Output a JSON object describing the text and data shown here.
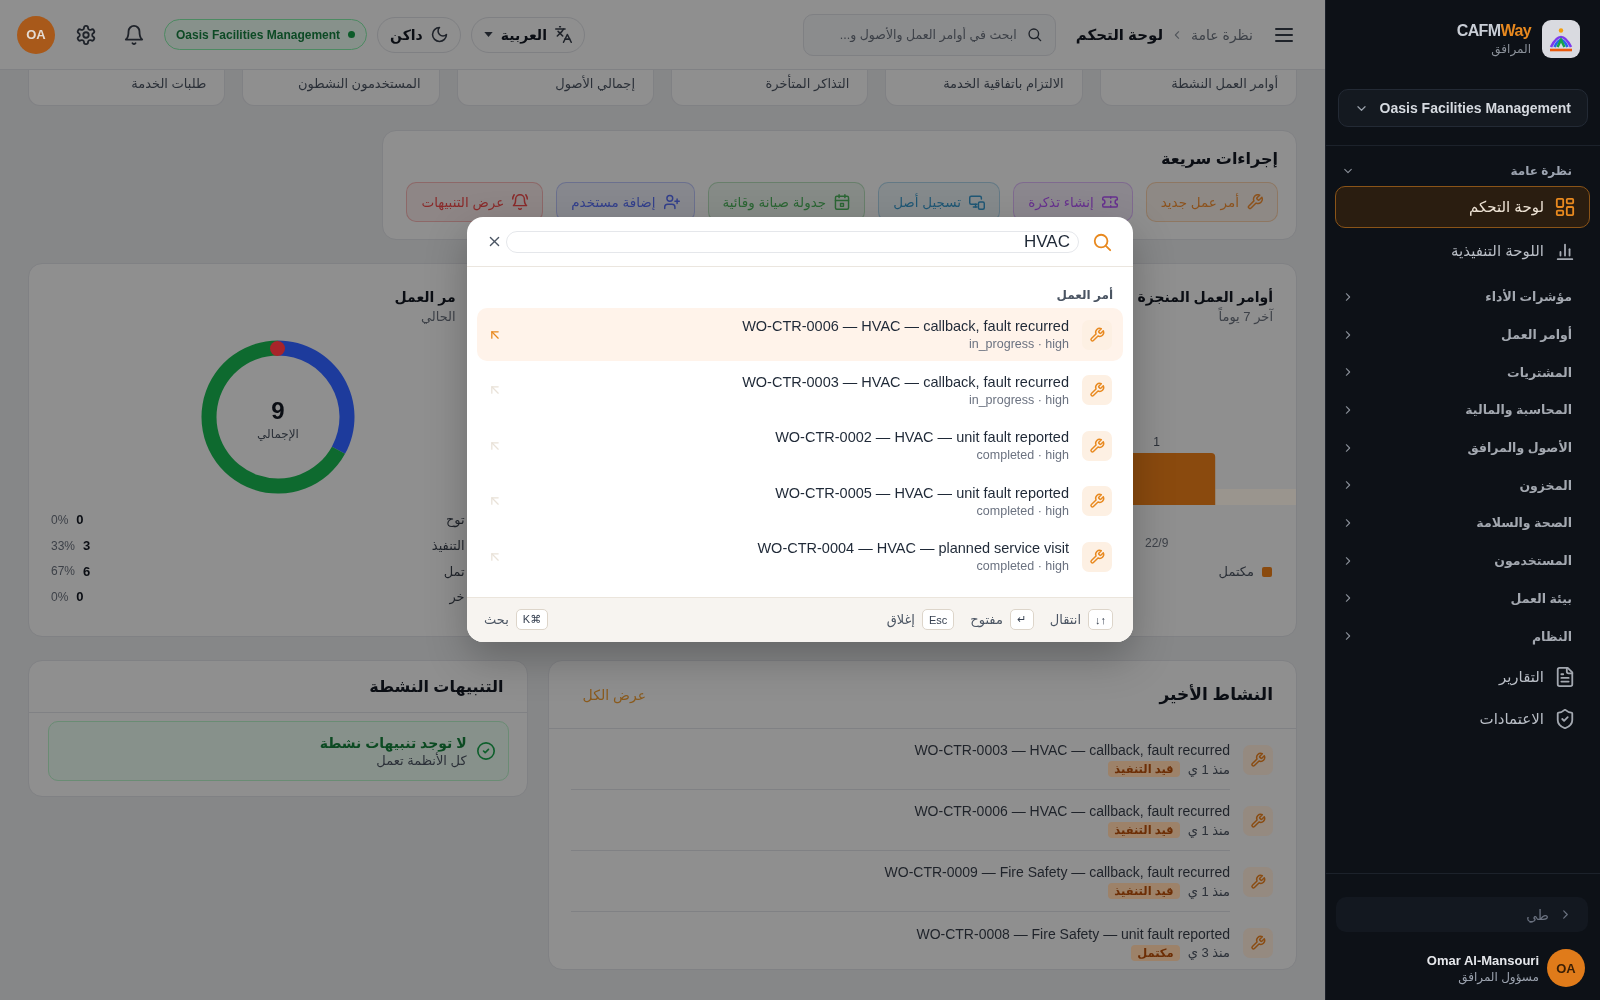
{
  "sidebar": {
    "brand": {
      "name": "CAFM",
      "accent": "Way",
      "subtitle": "المرافق"
    },
    "organization": "Oasis Facilities Management",
    "nav": [
      {
        "kind": "section",
        "label": "نظرة عامة",
        "expanded": true,
        "children": [
          {
            "label": "لوحة التحكم",
            "selected": true
          },
          {
            "label": "اللوحة التنفيذية",
            "selected": false
          }
        ]
      },
      {
        "kind": "group",
        "label": "مؤشرات الأداء",
        "expanded": false
      },
      {
        "kind": "group",
        "label": "أوامر العمل",
        "expanded": false
      },
      {
        "kind": "group",
        "label": "المشتريات",
        "expanded": false
      },
      {
        "kind": "group",
        "label": "المحاسبة والمالية",
        "expanded": false
      },
      {
        "kind": "group",
        "label": "الأصول والمرافق",
        "expanded": false
      },
      {
        "kind": "group",
        "label": "المخزون",
        "expanded": false
      },
      {
        "kind": "group",
        "label": "الصحة والسلامة",
        "expanded": false
      },
      {
        "kind": "group",
        "label": "المستخدمون",
        "expanded": false
      },
      {
        "kind": "group",
        "label": "بيئة العمل",
        "expanded": false
      },
      {
        "kind": "group",
        "label": "النظام",
        "expanded": false
      },
      {
        "kind": "link",
        "label": "التقارير",
        "selected": false
      },
      {
        "kind": "link",
        "label": "الاعتمادات",
        "selected": false
      }
    ],
    "collapse": "طي",
    "user": {
      "initials": "OA",
      "name": "Omar Al-Mansouri",
      "role": "مسؤول المرافق"
    }
  },
  "topbar": {
    "breadcrumb": [
      {
        "label": "نظرة عامة",
        "current": false
      },
      {
        "label": "لوحة التحكم",
        "current": true
      }
    ],
    "search": {
      "placeholder": "ابحث في أوامر العمل والأصول و..."
    },
    "language": "العربية",
    "theme": "داكن",
    "organization": "Oasis Facilities Management",
    "avatar": "OA"
  },
  "kpi_cards": [
    {
      "label": "أوامر العمل النشطة"
    },
    {
      "label": "الالتزام باتفاقية الخدمة"
    },
    {
      "label": "التذاكر المتأخرة"
    },
    {
      "label": "إجمالي الأصول"
    },
    {
      "label": "المستخدمون النشطون"
    },
    {
      "label": "طلبات الخدمة"
    }
  ],
  "quick_actions": {
    "title": "إجراءات سريعة",
    "buttons": [
      {
        "label": "أمر عمل جديد",
        "color": "#8c521c"
      },
      {
        "label": "إنشاء تذكرة",
        "color": "#67308f"
      },
      {
        "label": "تسجيل أصل",
        "color": "#1f5775"
      },
      {
        "label": "جدولة صيانة وقائية",
        "color": "#2b6634"
      },
      {
        "label": "إضافة مستخدم",
        "color": "#323f8c"
      },
      {
        "label": "عرض التنبيهات",
        "color": "#8a2a2a"
      }
    ]
  },
  "completed_card": {
    "title": "أوامر العمل المنجزة",
    "subtitle": "آخر 7 يوماً",
    "bar_value": "1",
    "date_label": "22/9",
    "legend": "مكتمل"
  },
  "status_card": {
    "title": "مر العمل",
    "subtitle": "الحالي",
    "total": "9",
    "total_label": "الإجمالي",
    "chart_data": {
      "type": "donut",
      "values": [
        0,
        33,
        67,
        0
      ],
      "colors": [
        null,
        "#1d3b9c",
        "#0e6a2f",
        "#a8242a"
      ]
    },
    "legend": [
      {
        "label": "توح",
        "count": "0",
        "percent": "0%"
      },
      {
        "label": "التنفيذ",
        "count": "3",
        "percent": "33%"
      },
      {
        "label": "تمل",
        "count": "6",
        "percent": "67%"
      },
      {
        "label": "خر",
        "count": "0",
        "percent": "0%"
      }
    ]
  },
  "activity_card": {
    "title": "النشاط الأخير",
    "view_all": "عرض الكل",
    "items": [
      {
        "title": "WO-CTR-0003 — HVAC — callback, fault recurred",
        "time": "منذ 1 ي",
        "status": "قيد التنفيذ"
      },
      {
        "title": "WO-CTR-0006 — HVAC — callback, fault recurred",
        "time": "منذ 1 ي",
        "status": "قيد التنفيذ"
      },
      {
        "title": "WO-CTR-0009 — Fire Safety — callback, fault recurred",
        "time": "منذ 1 ي",
        "status": "قيد التنفيذ"
      },
      {
        "title": "WO-CTR-0008 — Fire Safety — unit fault reported",
        "time": "منذ 3 ي",
        "status": "مكتمل"
      }
    ]
  },
  "alerts_card": {
    "title": "التنبيهات النشطة",
    "empty_title": "لا توجد تنبيهات نشطة",
    "empty_text": "كل الأنظمة تعمل"
  },
  "search_modal": {
    "query": "HVAC",
    "section": "أمر العمل",
    "results": [
      {
        "title": "WO-CTR-0006 — HVAC — callback, fault recurred",
        "meta": "in_progress · high",
        "selected": true
      },
      {
        "title": "WO-CTR-0003 — HVAC — callback, fault recurred",
        "meta": "in_progress · high",
        "selected": false
      },
      {
        "title": "WO-CTR-0002 — HVAC — unit fault reported",
        "meta": "completed · high",
        "selected": false
      },
      {
        "title": "WO-CTR-0005 — HVAC — unit fault reported",
        "meta": "completed · high",
        "selected": false
      },
      {
        "title": "WO-CTR-0004 — HVAC — planned service visit",
        "meta": "completed · high",
        "selected": false
      }
    ],
    "hints": [
      {
        "key": "↑↓",
        "label": "انتقال"
      },
      {
        "key": "↵",
        "label": "مفتوح"
      },
      {
        "key": "Esc",
        "label": "إغلاق"
      }
    ],
    "shortcut": {
      "key": "⌘K",
      "label": "بحث"
    }
  }
}
